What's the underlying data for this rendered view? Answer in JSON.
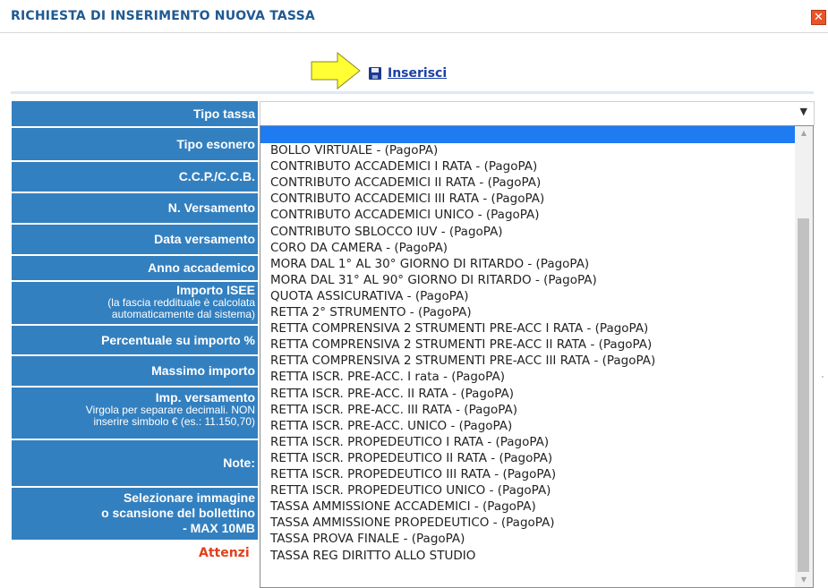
{
  "dialog": {
    "title": "RICHIESTA DI INSERIMENTO NUOVA TASSA",
    "close_symbol": "✕",
    "insert_label": "Inserisci"
  },
  "colors": {
    "title": "#1f5a92",
    "label_bg": "#3380c0",
    "highlight": "#1e7bf2",
    "arrow": "#ffff33"
  },
  "icons": {
    "arrow": "arrow-right-icon",
    "save": "floppy-disk-icon",
    "close": "close-icon"
  },
  "form": {
    "labels": [
      {
        "main": "Tipo tassa"
      },
      {
        "main": "Tipo esonero"
      },
      {
        "main": "C.C.P./C.C.B."
      },
      {
        "main": "N. Versamento"
      },
      {
        "main": "Data versamento"
      },
      {
        "main": "Anno accademico"
      },
      {
        "main": "Importo ISEE",
        "sub1": "(la fascia reddituale è calcolata",
        "sub2": "automaticamente dal sistema)"
      },
      {
        "main": "Percentuale su importo %"
      },
      {
        "main": "Massimo importo"
      },
      {
        "main": "Imp. versamento",
        "sub1": "Virgola per separare decimali. NON",
        "sub2": "inserire simbolo € (es.: 11.150,70)"
      },
      {
        "main": "Note:"
      },
      {
        "main": "Selezionare immagine",
        "main2": "o scansione del bollettino",
        "main3": "- MAX 10MB"
      }
    ],
    "tipo_tassa": {
      "selected": "",
      "options": [
        "",
        "BOLLO VIRTUALE - (PagoPA)",
        "CONTRIBUTO ACCADEMICI I RATA - (PagoPA)",
        "CONTRIBUTO ACCADEMICI II RATA - (PagoPA)",
        "CONTRIBUTO ACCADEMICI III RATA - (PagoPA)",
        "CONTRIBUTO ACCADEMICI UNICO - (PagoPA)",
        "CONTRIBUTO SBLOCCO IUV - (PagoPA)",
        "CORO DA CAMERA - (PagoPA)",
        "MORA DAL 1° AL 30° GIORNO DI RITARDO - (PagoPA)",
        "MORA DAL 31° AL 90° GIORNO DI RITARDO - (PagoPA)",
        "QUOTA ASSICURATIVA - (PagoPA)",
        "RETTA 2° STRUMENTO - (PagoPA)",
        "RETTA COMPRENSIVA 2 STRUMENTI PRE-ACC I RATA - (PagoPA)",
        "RETTA COMPRENSIVA 2 STRUMENTI PRE-ACC II RATA - (PagoPA)",
        "RETTA COMPRENSIVA 2 STRUMENTI PRE-ACC III RATA - (PagoPA)",
        "RETTA ISCR. PRE-ACC. I rata - (PagoPA)",
        "RETTA ISCR. PRE-ACC. II RATA - (PagoPA)",
        "RETTA ISCR. PRE-ACC. III RATA - (PagoPA)",
        "RETTA ISCR. PRE-ACC. UNICO - (PagoPA)",
        "RETTA ISCR. PROPEDEUTICO I RATA - (PagoPA)",
        "RETTA ISCR. PROPEDEUTICO II RATA - (PagoPA)",
        "RETTA ISCR. PROPEDEUTICO III RATA - (PagoPA)",
        "RETTA ISCR. PROPEDEUTICO UNICO - (PagoPA)",
        "TASSA AMMISSIONE ACCADEMICI - (PagoPA)",
        "TASSA AMMISSIONE PROPEDEUTICO - (PagoPA)",
        "TASSA PROVA FINALE - (PagoPA)",
        "TASSA REG DIRITTO ALLO STUDIO"
      ]
    }
  },
  "footer": {
    "attention_text": "Attenzi"
  }
}
